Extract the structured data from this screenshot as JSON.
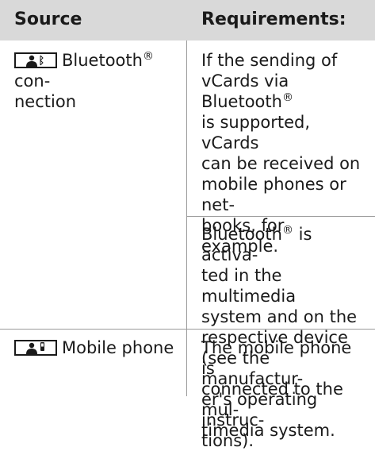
{
  "table": {
    "header": {
      "source": "Source",
      "requirements": "Requirements:"
    },
    "rows": [
      {
        "source_icon": "contact-bluetooth-icon",
        "source_label": [
          "Bluetooth",
          "®",
          " con-",
          "nection"
        ],
        "requirements": [
          [
            "If the sending of",
            "vCards via Bluetooth",
            "®",
            "is supported, vCards",
            "can be received on",
            "mobile phones or net-",
            "books, for example."
          ],
          [
            "Bluetooth",
            "®",
            " is activa-",
            "ted in the multimedia",
            "system and on the",
            "respective device",
            "(see the manufactur-",
            "er's operating instruc-",
            "tions)."
          ]
        ]
      },
      {
        "source_icon": "contact-mobile-phone-icon",
        "source_label": "Mobile phone",
        "requirements": [
          "The mobile phone is",
          "connected to the mul-",
          "timedia system."
        ]
      }
    ]
  }
}
